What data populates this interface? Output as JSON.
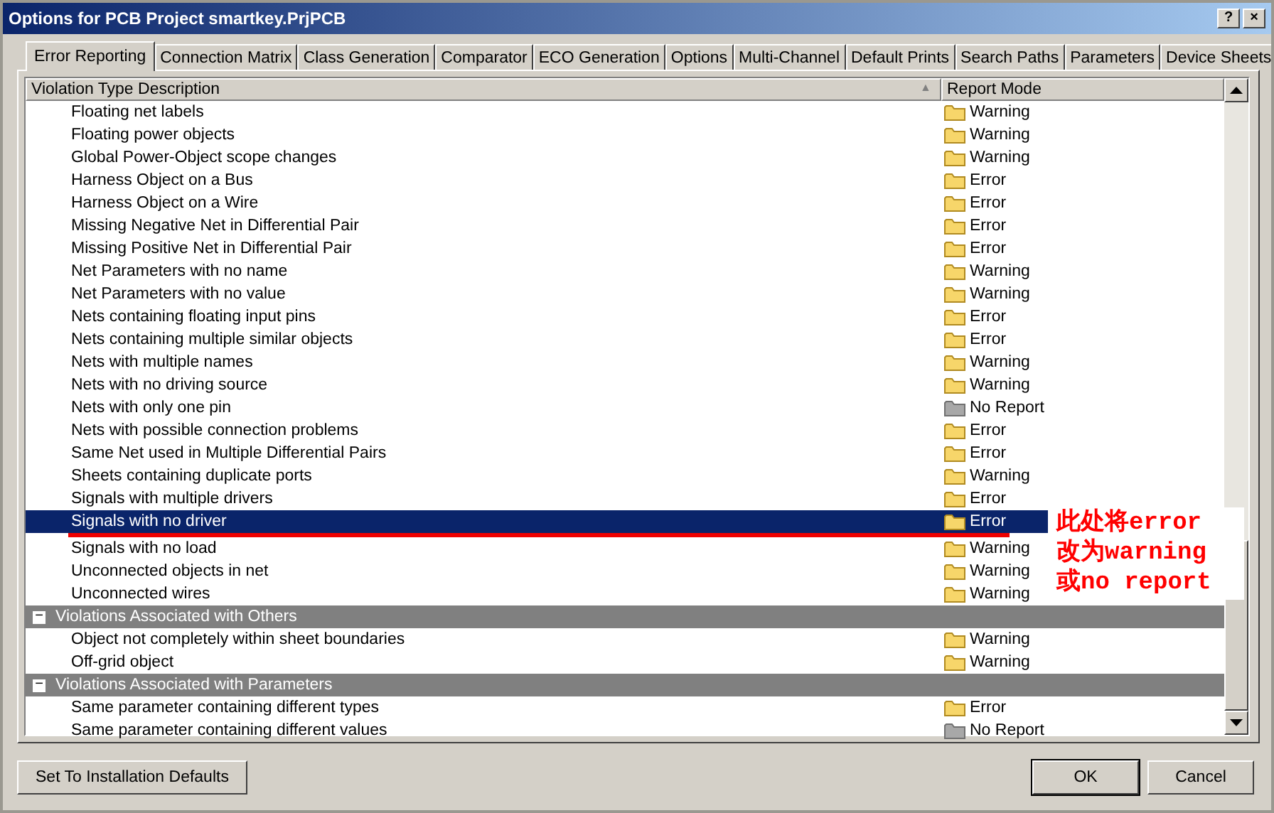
{
  "window": {
    "title": "Options for PCB Project smartkey.PrjPCB",
    "help_button": "?",
    "close_button": "×"
  },
  "tabs": [
    {
      "label": "Error Reporting",
      "selected": true
    },
    {
      "label": "Connection Matrix",
      "selected": false
    },
    {
      "label": "Class Generation",
      "selected": false
    },
    {
      "label": "Comparator",
      "selected": false
    },
    {
      "label": "ECO Generation",
      "selected": false
    },
    {
      "label": "Options",
      "selected": false
    },
    {
      "label": "Multi-Channel",
      "selected": false
    },
    {
      "label": "Default Prints",
      "selected": false
    },
    {
      "label": "Search Paths",
      "selected": false
    },
    {
      "label": "Parameters",
      "selected": false
    },
    {
      "label": "Device Sheets",
      "selected": false
    }
  ],
  "table": {
    "columns": [
      "Violation Type Description",
      "Report Mode"
    ],
    "sort_mark": "▲",
    "rows": [
      {
        "kind": "item",
        "description": "Floating net labels",
        "mode": "Warning",
        "enabled": true,
        "selected": false
      },
      {
        "kind": "item",
        "description": "Floating power objects",
        "mode": "Warning",
        "enabled": true,
        "selected": false
      },
      {
        "kind": "item",
        "description": "Global Power-Object scope changes",
        "mode": "Warning",
        "enabled": true,
        "selected": false
      },
      {
        "kind": "item",
        "description": "Harness Object on a Bus",
        "mode": "Error",
        "enabled": true,
        "selected": false
      },
      {
        "kind": "item",
        "description": "Harness Object on a Wire",
        "mode": "Error",
        "enabled": true,
        "selected": false
      },
      {
        "kind": "item",
        "description": "Missing Negative Net in Differential Pair",
        "mode": "Error",
        "enabled": true,
        "selected": false
      },
      {
        "kind": "item",
        "description": "Missing Positive Net in Differential Pair",
        "mode": "Error",
        "enabled": true,
        "selected": false
      },
      {
        "kind": "item",
        "description": "Net Parameters with no name",
        "mode": "Warning",
        "enabled": true,
        "selected": false
      },
      {
        "kind": "item",
        "description": "Net Parameters with no value",
        "mode": "Warning",
        "enabled": true,
        "selected": false
      },
      {
        "kind": "item",
        "description": "Nets containing floating input pins",
        "mode": "Error",
        "enabled": true,
        "selected": false
      },
      {
        "kind": "item",
        "description": "Nets containing multiple similar objects",
        "mode": "Error",
        "enabled": true,
        "selected": false
      },
      {
        "kind": "item",
        "description": "Nets with multiple names",
        "mode": "Warning",
        "enabled": true,
        "selected": false
      },
      {
        "kind": "item",
        "description": "Nets with no driving source",
        "mode": "Warning",
        "enabled": true,
        "selected": false
      },
      {
        "kind": "item",
        "description": "Nets with only one pin",
        "mode": "No Report",
        "enabled": false,
        "selected": false
      },
      {
        "kind": "item",
        "description": "Nets with possible connection problems",
        "mode": "Error",
        "enabled": true,
        "selected": false
      },
      {
        "kind": "item",
        "description": "Same Net used in Multiple Differential Pairs",
        "mode": "Error",
        "enabled": true,
        "selected": false
      },
      {
        "kind": "item",
        "description": "Sheets containing duplicate ports",
        "mode": "Warning",
        "enabled": true,
        "selected": false
      },
      {
        "kind": "item",
        "description": "Signals with multiple drivers",
        "mode": "Error",
        "enabled": true,
        "selected": false
      },
      {
        "kind": "item",
        "description": "Signals with no driver",
        "mode": "Error",
        "enabled": true,
        "selected": true
      },
      {
        "kind": "item",
        "description": "Signals with no load",
        "mode": "Warning",
        "enabled": true,
        "selected": false
      },
      {
        "kind": "item",
        "description": "Unconnected objects in net",
        "mode": "Warning",
        "enabled": true,
        "selected": false
      },
      {
        "kind": "item",
        "description": "Unconnected wires",
        "mode": "Warning",
        "enabled": true,
        "selected": false
      },
      {
        "kind": "group",
        "description": "Violations Associated with Others",
        "expanded": true,
        "toggle": "−"
      },
      {
        "kind": "item",
        "description": "Object not completely within sheet boundaries",
        "mode": "Warning",
        "enabled": true,
        "selected": false
      },
      {
        "kind": "item",
        "description": "Off-grid object",
        "mode": "Warning",
        "enabled": true,
        "selected": false
      },
      {
        "kind": "group",
        "description": "Violations Associated with Parameters",
        "expanded": true,
        "toggle": "−"
      },
      {
        "kind": "item",
        "description": "Same parameter containing different types",
        "mode": "Error",
        "enabled": true,
        "selected": false
      },
      {
        "kind": "item",
        "description": "Same parameter containing different values",
        "mode": "No Report",
        "enabled": false,
        "selected": false
      }
    ]
  },
  "annotation": {
    "lines": [
      "此处将error",
      "改为warning",
      "或no report"
    ]
  },
  "buttons": {
    "defaults": "Set To Installation Defaults",
    "ok": "OK",
    "cancel": "Cancel"
  }
}
